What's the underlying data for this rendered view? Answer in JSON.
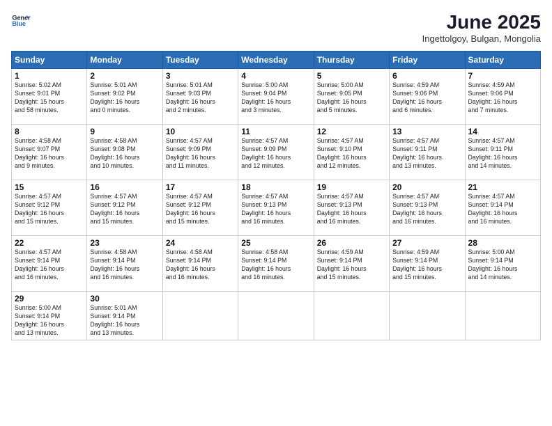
{
  "header": {
    "logo_line1": "General",
    "logo_line2": "Blue",
    "title": "June 2025",
    "subtitle": "Ingettolgoy, Bulgan, Mongolia"
  },
  "weekdays": [
    "Sunday",
    "Monday",
    "Tuesday",
    "Wednesday",
    "Thursday",
    "Friday",
    "Saturday"
  ],
  "weeks": [
    [
      {
        "day": "1",
        "info": "Sunrise: 5:02 AM\nSunset: 9:01 PM\nDaylight: 15 hours\nand 58 minutes."
      },
      {
        "day": "2",
        "info": "Sunrise: 5:01 AM\nSunset: 9:02 PM\nDaylight: 16 hours\nand 0 minutes."
      },
      {
        "day": "3",
        "info": "Sunrise: 5:01 AM\nSunset: 9:03 PM\nDaylight: 16 hours\nand 2 minutes."
      },
      {
        "day": "4",
        "info": "Sunrise: 5:00 AM\nSunset: 9:04 PM\nDaylight: 16 hours\nand 3 minutes."
      },
      {
        "day": "5",
        "info": "Sunrise: 5:00 AM\nSunset: 9:05 PM\nDaylight: 16 hours\nand 5 minutes."
      },
      {
        "day": "6",
        "info": "Sunrise: 4:59 AM\nSunset: 9:06 PM\nDaylight: 16 hours\nand 6 minutes."
      },
      {
        "day": "7",
        "info": "Sunrise: 4:59 AM\nSunset: 9:06 PM\nDaylight: 16 hours\nand 7 minutes."
      }
    ],
    [
      {
        "day": "8",
        "info": "Sunrise: 4:58 AM\nSunset: 9:07 PM\nDaylight: 16 hours\nand 9 minutes."
      },
      {
        "day": "9",
        "info": "Sunrise: 4:58 AM\nSunset: 9:08 PM\nDaylight: 16 hours\nand 10 minutes."
      },
      {
        "day": "10",
        "info": "Sunrise: 4:57 AM\nSunset: 9:09 PM\nDaylight: 16 hours\nand 11 minutes."
      },
      {
        "day": "11",
        "info": "Sunrise: 4:57 AM\nSunset: 9:09 PM\nDaylight: 16 hours\nand 12 minutes."
      },
      {
        "day": "12",
        "info": "Sunrise: 4:57 AM\nSunset: 9:10 PM\nDaylight: 16 hours\nand 12 minutes."
      },
      {
        "day": "13",
        "info": "Sunrise: 4:57 AM\nSunset: 9:11 PM\nDaylight: 16 hours\nand 13 minutes."
      },
      {
        "day": "14",
        "info": "Sunrise: 4:57 AM\nSunset: 9:11 PM\nDaylight: 16 hours\nand 14 minutes."
      }
    ],
    [
      {
        "day": "15",
        "info": "Sunrise: 4:57 AM\nSunset: 9:12 PM\nDaylight: 16 hours\nand 15 minutes."
      },
      {
        "day": "16",
        "info": "Sunrise: 4:57 AM\nSunset: 9:12 PM\nDaylight: 16 hours\nand 15 minutes."
      },
      {
        "day": "17",
        "info": "Sunrise: 4:57 AM\nSunset: 9:12 PM\nDaylight: 16 hours\nand 15 minutes."
      },
      {
        "day": "18",
        "info": "Sunrise: 4:57 AM\nSunset: 9:13 PM\nDaylight: 16 hours\nand 16 minutes."
      },
      {
        "day": "19",
        "info": "Sunrise: 4:57 AM\nSunset: 9:13 PM\nDaylight: 16 hours\nand 16 minutes."
      },
      {
        "day": "20",
        "info": "Sunrise: 4:57 AM\nSunset: 9:13 PM\nDaylight: 16 hours\nand 16 minutes."
      },
      {
        "day": "21",
        "info": "Sunrise: 4:57 AM\nSunset: 9:14 PM\nDaylight: 16 hours\nand 16 minutes."
      }
    ],
    [
      {
        "day": "22",
        "info": "Sunrise: 4:57 AM\nSunset: 9:14 PM\nDaylight: 16 hours\nand 16 minutes."
      },
      {
        "day": "23",
        "info": "Sunrise: 4:58 AM\nSunset: 9:14 PM\nDaylight: 16 hours\nand 16 minutes."
      },
      {
        "day": "24",
        "info": "Sunrise: 4:58 AM\nSunset: 9:14 PM\nDaylight: 16 hours\nand 16 minutes."
      },
      {
        "day": "25",
        "info": "Sunrise: 4:58 AM\nSunset: 9:14 PM\nDaylight: 16 hours\nand 16 minutes."
      },
      {
        "day": "26",
        "info": "Sunrise: 4:59 AM\nSunset: 9:14 PM\nDaylight: 16 hours\nand 15 minutes."
      },
      {
        "day": "27",
        "info": "Sunrise: 4:59 AM\nSunset: 9:14 PM\nDaylight: 16 hours\nand 15 minutes."
      },
      {
        "day": "28",
        "info": "Sunrise: 5:00 AM\nSunset: 9:14 PM\nDaylight: 16 hours\nand 14 minutes."
      }
    ],
    [
      {
        "day": "29",
        "info": "Sunrise: 5:00 AM\nSunset: 9:14 PM\nDaylight: 16 hours\nand 13 minutes."
      },
      {
        "day": "30",
        "info": "Sunrise: 5:01 AM\nSunset: 9:14 PM\nDaylight: 16 hours\nand 13 minutes."
      },
      null,
      null,
      null,
      null,
      null
    ]
  ]
}
